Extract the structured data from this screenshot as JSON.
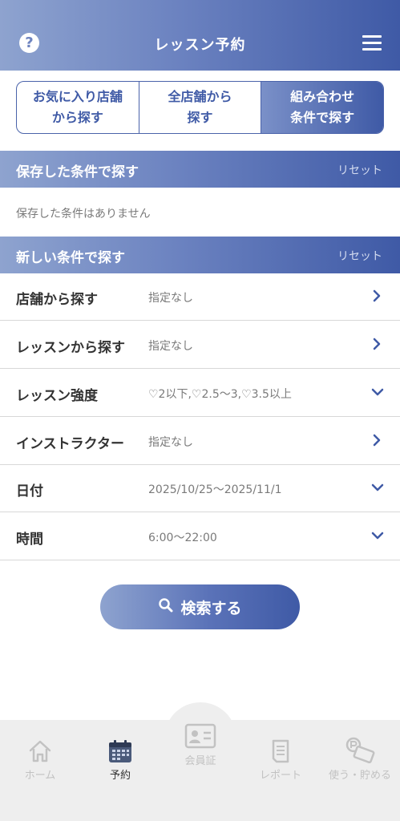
{
  "header": {
    "title": "レッスン予約",
    "help_icon": "question-circle-icon",
    "menu_icon": "hamburger-menu-icon"
  },
  "segments": [
    {
      "label": "お気に入り店舗\nから探す",
      "active": false
    },
    {
      "label": "全店舗から\n探す",
      "active": false
    },
    {
      "label": "組み合わせ\n条件で探す",
      "active": true
    }
  ],
  "saved": {
    "title": "保存した条件で探す",
    "reset": "リセット",
    "empty_message": "保存した条件はありません"
  },
  "new_search": {
    "title": "新しい条件で探す",
    "reset": "リセット"
  },
  "conditions": [
    {
      "label": "店舗から探す",
      "value": "指定なし",
      "icon": "chevron-right-icon"
    },
    {
      "label": "レッスンから探す",
      "value": "指定なし",
      "icon": "chevron-right-icon"
    },
    {
      "label": "レッスン強度",
      "value": "♡2以下,♡2.5〜3,♡3.5以上",
      "icon": "chevron-down-icon"
    },
    {
      "label": "インストラクター",
      "value": "指定なし",
      "icon": "chevron-right-icon"
    },
    {
      "label": "日付",
      "value": "2025/10/25〜2025/11/1",
      "icon": "chevron-down-icon"
    },
    {
      "label": "時間",
      "value": "6:00〜22:00",
      "icon": "chevron-down-icon"
    }
  ],
  "search_button": {
    "label": "検索する",
    "icon": "search-icon"
  },
  "nav": [
    {
      "label": "ホーム",
      "icon": "home-icon",
      "active": false
    },
    {
      "label": "予約",
      "icon": "calendar-icon",
      "active": true
    },
    {
      "label": "会員証",
      "icon": "member-card-icon",
      "active": false
    },
    {
      "label": "レポート",
      "icon": "report-icon",
      "active": false
    },
    {
      "label": "使う・貯める",
      "icon": "point-card-icon",
      "active": false
    }
  ],
  "colors": {
    "accent": "#3f5aa6",
    "accent_light": "#8ea3cf",
    "divider": "#d8d8d8",
    "nav_bg": "#eeeeee"
  }
}
